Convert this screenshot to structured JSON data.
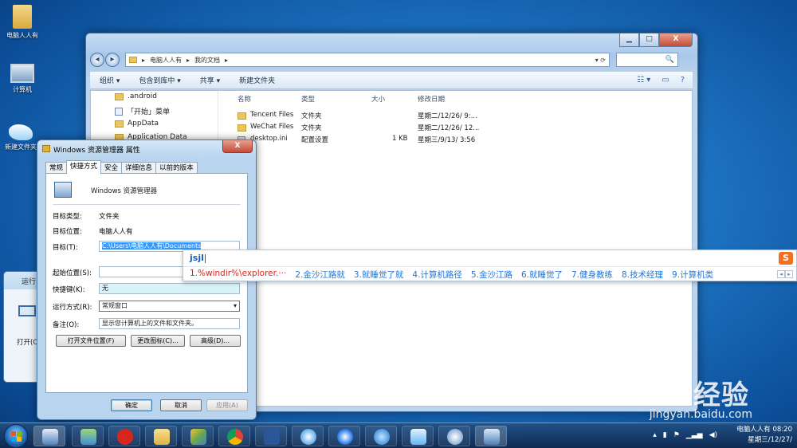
{
  "desktop": {
    "icons": [
      {
        "label": "电脑人人有"
      },
      {
        "label": "计算机"
      },
      {
        "label": "新建文件夹"
      }
    ]
  },
  "explorer": {
    "window_controls": {
      "minimize": "▁",
      "maximize": "□",
      "close": "X"
    },
    "address": {
      "seg1": "电脑人人有",
      "seg2": "我的文档",
      "sep": "▸"
    },
    "search_placeholder": "🔍",
    "toolbar": {
      "organize": "组织 ▾",
      "include_in_library": "包含到库中 ▾",
      "share": "共享 ▾",
      "new_folder": "新建文件夹"
    },
    "nav_items": [
      ".android",
      "「开始」菜单",
      "AppData",
      "Application Data"
    ],
    "columns": {
      "name": "名称",
      "type": "类型",
      "size": "大小",
      "modified": "修改日期"
    },
    "files": [
      {
        "name": "Tencent Files",
        "type": "文件夹",
        "size": "",
        "modified": "星期二/12/26/ 9:..."
      },
      {
        "name": "WeChat Files",
        "type": "文件夹",
        "size": "",
        "modified": "星期二/12/26/ 12..."
      },
      {
        "name": "desktop.ini",
        "type": "配置设置",
        "size": "1 KB",
        "modified": "星期三/9/13/ 3:56"
      }
    ]
  },
  "properties": {
    "title": "Windows 资源管理器 属性",
    "close": "X",
    "tabs": [
      "常规",
      "快捷方式",
      "安全",
      "详细信息",
      "以前的版本"
    ],
    "app_name": "Windows 资源管理器",
    "target_type_label": "目标类型:",
    "target_type_value": "文件夹",
    "target_location_label": "目标位置:",
    "target_location_value": "电脑人人有",
    "target_label": "目标(T):",
    "target_value": "C:\\Users\\电脑人人有\\Documents",
    "start_in_label": "起始位置(S):",
    "shortcut_key_label": "快捷键(K):",
    "shortcut_key_value": "无",
    "run_label": "运行方式(R):",
    "run_value": "常规窗口",
    "comment_label": "备注(O):",
    "comment_value": "显示您计算机上的文件和文件夹。",
    "btn_open_location": "打开文件位置(F)",
    "btn_change_icon": "更改图标(C)...",
    "btn_advanced": "高级(D)...",
    "btn_ok": "确定",
    "btn_cancel": "取消",
    "btn_apply": "应用(A)"
  },
  "run_dialog": {
    "title": "运行",
    "open_label": "打开(O"
  },
  "ime": {
    "input": "jsjl",
    "candidates": [
      "1.%windir%\\explorer.···",
      "2.金沙江路就",
      "3.就睡觉了就",
      "4.计算机路径",
      "5.金沙江路",
      "6.就睡觉了",
      "7.健身教练",
      "8.技术经理",
      "9.计算机类"
    ],
    "logo": "S",
    "prev": "◂",
    "next": "▸"
  },
  "taskbar": {
    "time": "08:20",
    "user": "电脑人人有",
    "date": "星期三/12/27/"
  },
  "watermark": {
    "brand": "Bai  经验",
    "url": "jingyan.baidu.com"
  }
}
